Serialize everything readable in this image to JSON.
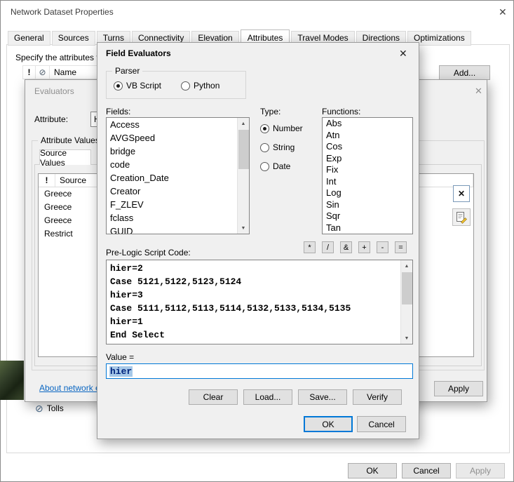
{
  "icons": {
    "close": "✕",
    "exclamation": "!",
    "prohibit": "⊘",
    "scroll_up": "▲",
    "scroll_down": "▼",
    "delete": "✕"
  },
  "colors": {
    "accent": "#0078d7",
    "link": "#0a66c2",
    "selection_bg": "#a6c8e8",
    "selection_text": "#00247d"
  },
  "main_window": {
    "title": "Network Dataset Properties",
    "tabs": [
      "General",
      "Sources",
      "Turns",
      "Connectivity",
      "Elevation",
      "Attributes",
      "Travel Modes",
      "Directions",
      "Optimizations"
    ],
    "selected_tab": "Attributes",
    "instruction": "Specify the attributes f",
    "list_header": {
      "name": "Name"
    },
    "add_button": "Add...",
    "tolls_row": "Tolls",
    "footer": {
      "ok": "OK",
      "cancel": "Cancel",
      "apply": "Apply"
    }
  },
  "evaluators_dialog": {
    "title": "Evaluators",
    "attribute_label": "Attribute:",
    "attribute_value": "H",
    "group_label": "Attribute Values",
    "tab_label": "Source Values",
    "table": {
      "col_exclaim": "!",
      "col_source": "Source",
      "rows": [
        "Greece",
        "Greece",
        "Greece",
        "Restrict"
      ]
    },
    "about_link": "About network e",
    "apply_button": "Apply"
  },
  "field_evaluators_dialog": {
    "title": "Field Evaluators",
    "parser": {
      "label": "Parser",
      "options": [
        "VB Script",
        "Python"
      ],
      "selected": "VB Script"
    },
    "fields": {
      "label": "Fields:",
      "items": [
        "Access",
        "AVGSpeed",
        "bridge",
        "code",
        "Creation_Date",
        "Creator",
        "F_ZLEV",
        "fclass",
        "GUID"
      ]
    },
    "type": {
      "label": "Type:",
      "options": [
        "Number",
        "String",
        "Date"
      ],
      "selected": "Number"
    },
    "functions": {
      "label": "Functions:",
      "items": [
        "Abs",
        "Atn",
        "Cos",
        "Exp",
        "Fix",
        "Int",
        "Log",
        "Sin",
        "Sqr",
        "Tan"
      ]
    },
    "prelogic_label": "Pre-Logic Script Code:",
    "operators": [
      "*",
      "/",
      "&",
      "+",
      "-",
      "="
    ],
    "script_code": "hier=2\nCase 5121,5122,5123,5124\nhier=3\nCase 5111,5112,5113,5114,5132,5133,5134,5135\nhier=1\nEnd Select",
    "value_label": "Value =",
    "value_text": "hier",
    "buttons": {
      "clear": "Clear",
      "load": "Load...",
      "save": "Save...",
      "verify": "Verify",
      "ok": "OK",
      "cancel": "Cancel"
    }
  }
}
